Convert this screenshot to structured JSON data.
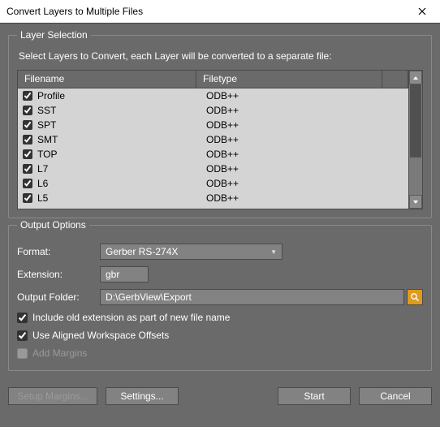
{
  "window": {
    "title": "Convert Layers to Multiple Files"
  },
  "layerSelection": {
    "legend": "Layer Selection",
    "instruction": "Select Layers to Convert, each Layer will be converted to a separate file:",
    "columns": {
      "filename": "Filename",
      "filetype": "Filetype"
    },
    "rows": [
      {
        "name": "Profile",
        "type": "ODB++",
        "checked": true
      },
      {
        "name": "SST",
        "type": "ODB++",
        "checked": true
      },
      {
        "name": "SPT",
        "type": "ODB++",
        "checked": true
      },
      {
        "name": "SMT",
        "type": "ODB++",
        "checked": true
      },
      {
        "name": "TOP",
        "type": "ODB++",
        "checked": true
      },
      {
        "name": "L7",
        "type": "ODB++",
        "checked": true
      },
      {
        "name": "L6",
        "type": "ODB++",
        "checked": true
      },
      {
        "name": "L5",
        "type": "ODB++",
        "checked": true
      }
    ]
  },
  "outputOptions": {
    "legend": "Output Options",
    "formatLabel": "Format:",
    "formatValue": "Gerber RS-274X",
    "extensionLabel": "Extension:",
    "extensionValue": "gbr",
    "folderLabel": "Output Folder:",
    "folderValue": "D:\\GerbView\\Export",
    "includeOldExt": {
      "label": "Include old extension as part of new file name",
      "checked": true
    },
    "alignedOffsets": {
      "label": "Use Aligned Workspace Offsets",
      "checked": true
    },
    "addMargins": {
      "label": "Add Margins",
      "checked": false
    }
  },
  "buttons": {
    "setupMargins": "Setup Margins...",
    "settings": "Settings...",
    "start": "Start",
    "cancel": "Cancel"
  }
}
